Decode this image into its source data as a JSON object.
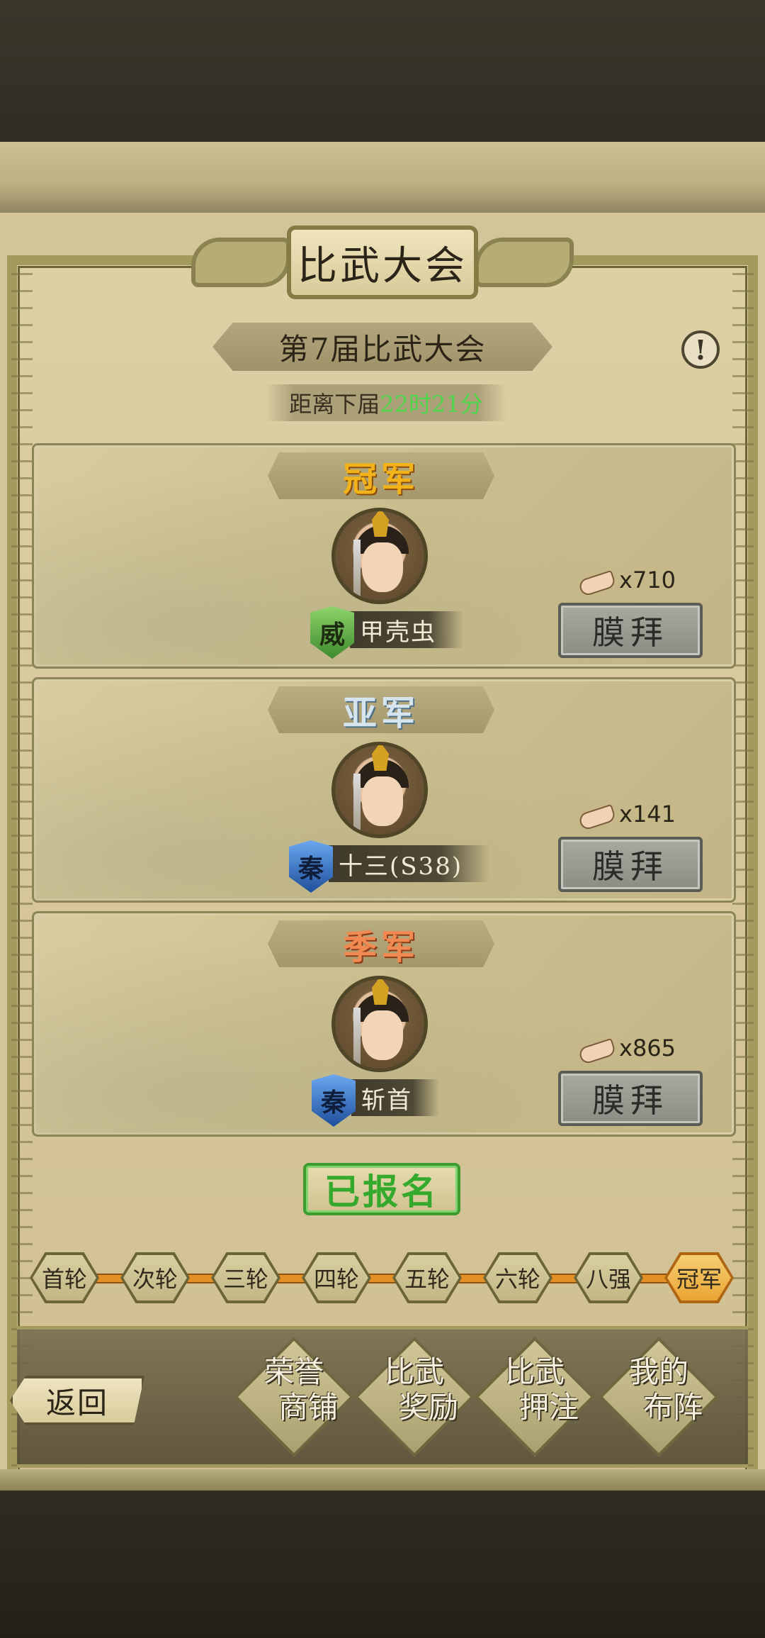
{
  "page": {
    "title": "比武大会"
  },
  "event": {
    "session_title": "第7届比武大会",
    "countdown_label": "距离下届",
    "countdown_time": "22时21分"
  },
  "podium": [
    {
      "rank": "冠军",
      "rank_color": "#f2b21a",
      "faction": "威",
      "faction_color": "#3e8a2e",
      "name": "甲壳虫",
      "worship_count": "x710",
      "worship_label": "膜拜"
    },
    {
      "rank": "亚军",
      "rank_color": "#d6e4ee",
      "faction": "秦",
      "faction_color": "#1f4f9c",
      "name": "十三(S38)",
      "worship_count": "x141",
      "worship_label": "膜拜"
    },
    {
      "rank": "季军",
      "rank_color": "#f08a52",
      "faction": "秦",
      "faction_color": "#1f4f9c",
      "name": "斩首",
      "worship_count": "x865",
      "worship_label": "膜拜"
    }
  ],
  "signup": {
    "label": "已报名"
  },
  "rounds": [
    "首轮",
    "次轮",
    "三轮",
    "四轮",
    "五轮",
    "六轮",
    "八强",
    "冠军"
  ],
  "active_round_index": 7,
  "bottom_menu": {
    "back": "返回",
    "items": [
      {
        "line1": "荣誉",
        "line2": "商铺"
      },
      {
        "line1": "比武",
        "line2": "奖励"
      },
      {
        "line1": "比武",
        "line2": "押注"
      },
      {
        "line1": "我的",
        "line2": "布阵"
      }
    ]
  }
}
